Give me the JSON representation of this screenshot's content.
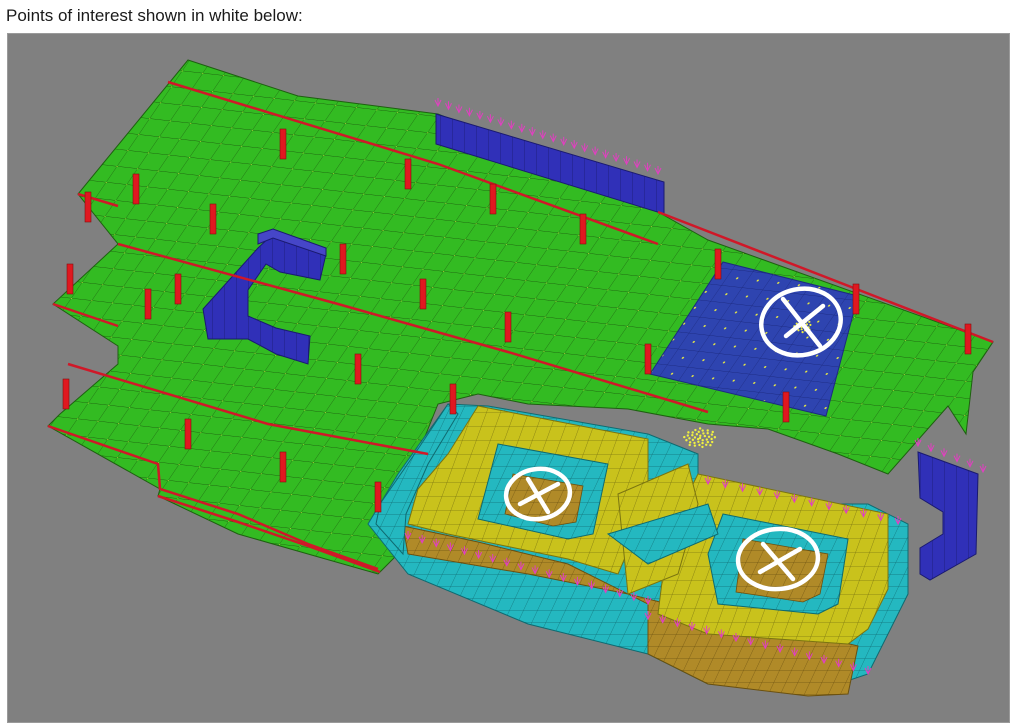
{
  "caption": "Points of interest shown in white below:",
  "colors": {
    "viewport_bg": "#808080",
    "slab": "#33bb22",
    "wall": "#3030b8",
    "pool_slab": "#2e44b0",
    "yellow_wall": "#c9c21c",
    "brown_floor": "#b08a28",
    "cyan_floor": "#24b8c0",
    "column": "#e01820",
    "marker": "#ffffff",
    "mesh_line": "#1e6010",
    "node": "#f0f040",
    "support": "#e040c0"
  },
  "markers": [
    {
      "name": "marker-circle-1",
      "icon": "circled-x-icon"
    },
    {
      "name": "marker-circle-2",
      "icon": "circled-x-icon"
    },
    {
      "name": "marker-circle-3",
      "icon": "circled-x-icon"
    }
  ]
}
